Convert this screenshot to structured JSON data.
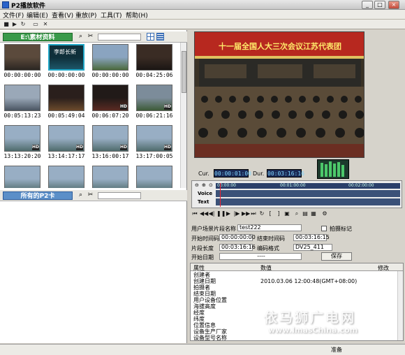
{
  "window": {
    "title": "P2播放软件"
  },
  "menu": [
    "文件(F)",
    "编辑(E)",
    "查看(V)",
    "重放(P)",
    "工具(T)",
    "帮助(H)"
  ],
  "browser": {
    "folder_label": "E:\\素材资料",
    "thumbnails": [
      {
        "tc": "00:00:00:00",
        "hd": false,
        "selected": false,
        "kind": "people"
      },
      {
        "tc": "00:00:00:00",
        "hd": false,
        "selected": true,
        "kind": "title",
        "caption": "李郎长新"
      },
      {
        "tc": "00:00:00:00",
        "hd": false,
        "selected": false,
        "kind": "landscape"
      },
      {
        "tc": "00:04:25:06",
        "hd": false,
        "selected": false,
        "kind": "person"
      },
      {
        "tc": "00:05:13:23",
        "hd": false,
        "selected": false,
        "kind": "street"
      },
      {
        "tc": "00:05:49:04",
        "hd": false,
        "selected": false,
        "kind": "hall"
      },
      {
        "tc": "00:06:07:20",
        "hd": true,
        "selected": false,
        "kind": "dark"
      },
      {
        "tc": "00:06:21:16",
        "hd": true,
        "selected": false,
        "kind": "bus"
      },
      {
        "tc": "13:13:20:20",
        "hd": true,
        "selected": false,
        "kind": "river"
      },
      {
        "tc": "13:14:17:17",
        "hd": true,
        "selected": false,
        "kind": "river"
      },
      {
        "tc": "13:16:00:17",
        "hd": true,
        "selected": false,
        "kind": "river"
      },
      {
        "tc": "13:17:00:05",
        "hd": true,
        "selected": false,
        "kind": "river"
      },
      {
        "tc": "",
        "hd": false,
        "selected": false,
        "kind": "river"
      },
      {
        "tc": "",
        "hd": false,
        "selected": false,
        "kind": "river"
      },
      {
        "tc": "",
        "hd": false,
        "selected": false,
        "kind": "river"
      },
      {
        "tc": "",
        "hd": false,
        "selected": false,
        "kind": "river"
      }
    ]
  },
  "card_panel": {
    "label": "所有的P2卡"
  },
  "preview": {
    "banner": "十一届全国人大三次会议江苏代表团",
    "cur_label": "Cur.",
    "cur_tc": "00:00:01:00",
    "dur_label": "Dur.",
    "dur_tc": "00:03:16:16"
  },
  "timeline": {
    "voice_label": "Voice",
    "text_label": "Text",
    "ruler_marks": [
      "00:00:00",
      "00:01:00:00",
      "00:02:00:00"
    ]
  },
  "form": {
    "name_label": "用户场景片段名称",
    "name_value": "test222",
    "shot_mark_label": "拍摄标记",
    "start_label": "开始时间码",
    "start_value": "00:00:00:00",
    "end_label": "结束时间码",
    "end_value": "00:03:16:15",
    "length_label": "片段长度",
    "length_value": "00:03:16:16",
    "format_label": "编码格式",
    "format_value": "DV25_411",
    "date_label": "开始日期",
    "date_value": "----",
    "save_label": "保存"
  },
  "properties": {
    "col_attr": "属性",
    "col_value": "数值",
    "col_modify": "修改",
    "rows": [
      {
        "attr": "创建者",
        "value": ""
      },
      {
        "attr": "创建日期",
        "value": "2010.03.06 12:00:48(GMT+08:00)"
      },
      {
        "attr": "拍摄者",
        "value": ""
      },
      {
        "attr": "结束日期",
        "value": ""
      },
      {
        "attr": "用户设备位置",
        "value": ""
      },
      {
        "attr": "海拔高度",
        "value": ""
      },
      {
        "attr": "经度",
        "value": ""
      },
      {
        "attr": "纬度",
        "value": ""
      },
      {
        "attr": "位置信息",
        "value": ""
      },
      {
        "attr": "设备生产厂家",
        "value": ""
      },
      {
        "attr": "设备型号名称",
        "value": ""
      }
    ]
  },
  "status": {
    "text": "准备"
  },
  "watermark": {
    "line1": "依马狮广电网",
    "line2": "www.ImasChina.com"
  }
}
